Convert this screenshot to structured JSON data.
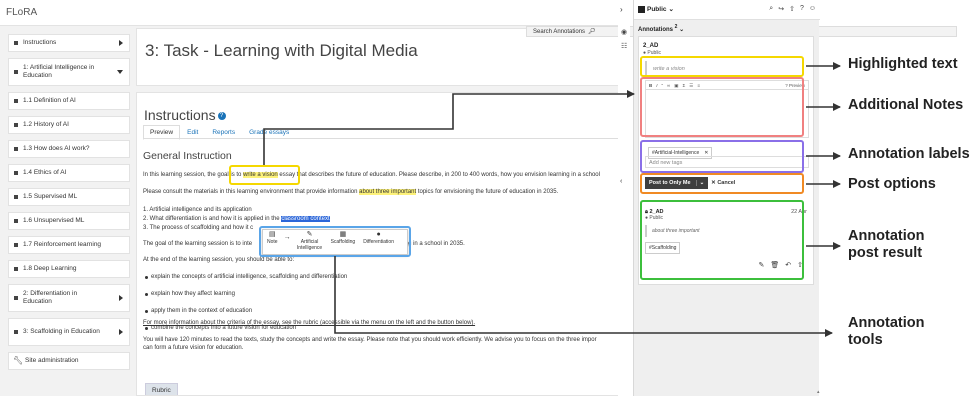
{
  "app": {
    "brand": "FLoRA"
  },
  "sidebar": {
    "items": [
      {
        "label": "Instructions",
        "caret": "right"
      },
      {
        "label": "1: Artificial Intelligence in Education",
        "caret": "down"
      },
      {
        "label": "1.1 Definition of AI"
      },
      {
        "label": "1.2 History of AI"
      },
      {
        "label": "1.3 How does AI work?"
      },
      {
        "label": "1.4 Ethics of AI"
      },
      {
        "label": "1.5 Supervised ML"
      },
      {
        "label": "1.6 Unsupervised ML"
      },
      {
        "label": "1.7 Reinforcement learning"
      },
      {
        "label": "1.8 Deep Learning"
      },
      {
        "label": "2: Differentiation in Education",
        "caret": "right"
      },
      {
        "label": "3: Scaffolding in Education",
        "caret": "right"
      },
      {
        "label": "Site administration",
        "icon": "wrench-icon"
      }
    ]
  },
  "main": {
    "task_title": "3: Task - Learning with Digital Media",
    "search_annotations": "Search Annotations",
    "instructions_title": "Instructions",
    "tabs": [
      "Preview",
      "Edit",
      "Reports",
      "Grade essays"
    ],
    "general_title": "General Instruction",
    "p1_a": "In this learning session, the goal is to ",
    "p1_hl": "write a vision",
    "p1_b": " essay that describes the future of education. Please describe, in 200 to 400 words, how you envision learning in a school",
    "p2_a": "Please consult the materials in this learning environment that provide information ",
    "p2_hl": "about three important",
    "p2_b": " topics for envisioning the future of education in 2035.",
    "list1": "1. Artificial intelligence and its application",
    "list2_a": "2. What differentiation is and how it is applied in the ",
    "list2_sel": "classroom context",
    "list3": "3. The process of scaffolding and how it c",
    "p3_a": "The goal of the learning session is to inte",
    "p3_b": "rning in a school in 2035.",
    "p4": "At the end of the learning session, you should be able to:",
    "bullets": [
      "explain the concepts of artificial intelligence, scaffolding and differentiation",
      "explain how they affect learning",
      "apply them in the context of education",
      "combine the concepts into a future vision for education"
    ],
    "rubric_link": "For more information about the criteria of the essay, see the rubric (accessible via the menu on the left and the button below).",
    "p5_1": "You will have 120 minutes to read the texts, study the concepts and write the essay. Please note that you should work efficiently. We advise you to focus on the three impor",
    "p5_2": "can form a future vision for education.",
    "rubric_button": "Rubric"
  },
  "tools": {
    "items": [
      {
        "label": "Note",
        "icon": "note-icon"
      },
      {
        "label": "Artificial Intelligence",
        "icon": "pen-icon"
      },
      {
        "label": "Scaffolding",
        "icon": "scaffold-icon"
      },
      {
        "label": "Differentiation",
        "icon": "exclamation-icon"
      }
    ]
  },
  "panel": {
    "group": "Public",
    "annotations_label": "Annotations",
    "annotations_count": "2",
    "user": "2_AD",
    "visibility": "Public",
    "quote_placeholder": "write a vision",
    "preview": "Preview",
    "tag": "#Artificial-Intelligence",
    "add_tags_placeholder": "Add new tags",
    "post_button": "Post to Only Me",
    "cancel": "Cancel",
    "result": {
      "user": "2_AD",
      "visibility": "Public",
      "date": "22 Apr",
      "quote": "about three important",
      "tag": "#Scaffolding"
    }
  },
  "callouts": [
    {
      "label": "Highlighted text",
      "color": "#f5d800"
    },
    {
      "label": "Additional Notes",
      "color": "#f08080"
    },
    {
      "label": "Annotation labels",
      "color": "#8a6fe8"
    },
    {
      "label": "Post options",
      "color": "#f08a24"
    },
    {
      "label": "Annotation post result",
      "color": "#3cbf3c"
    },
    {
      "label": "Annotation tools",
      "color": "#5aa5e8"
    }
  ]
}
